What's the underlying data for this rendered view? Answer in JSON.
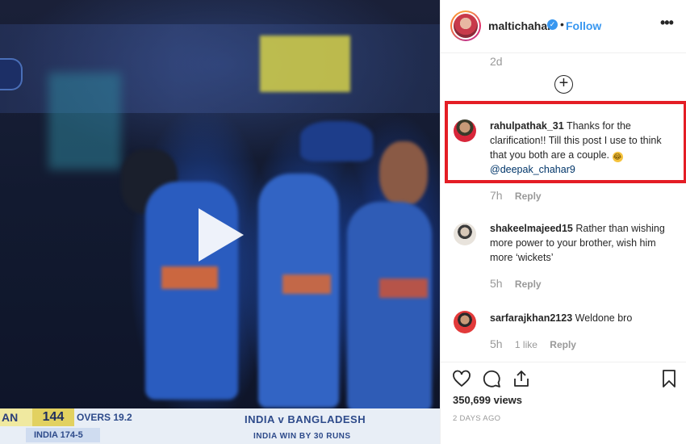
{
  "video": {
    "scoreboard": {
      "team": "AN",
      "score": "144",
      "overs": "OVERS 19.2",
      "innings": "INDIA 174-5 (20)",
      "match": "INDIA v BANGLADESH",
      "result": "INDIA WIN BY 30 RUNS"
    }
  },
  "post": {
    "username": "maltichahar",
    "verified_glyph": "✓",
    "separator": "•",
    "follow_label": "Follow",
    "more_glyph": "•••",
    "caption_time": "2d",
    "load_more_glyph": "+",
    "views": "350,699 views",
    "posted": "2 DAYS AGO"
  },
  "comments": [
    {
      "user": "rahulpathak_31",
      "text": "Thanks for the clarification!! Till this post I use to think that you both are a couple.",
      "emoji": "😂",
      "mention": "@deepak_chahar9",
      "time": "7h",
      "likes": "",
      "reply": "Reply"
    },
    {
      "user": "shakeelmajeed15",
      "text": "Rather than wishing more power to your brother, wish him more ‘wickets’",
      "time": "5h",
      "likes": "",
      "reply": "Reply"
    },
    {
      "user": "sarfarajkhan2123",
      "text": "Weldone bro",
      "time": "5h",
      "likes": "1 like",
      "reply": "Reply"
    }
  ],
  "icons": {
    "like": "heart-icon",
    "comment": "comment-icon",
    "share": "share-icon",
    "save": "bookmark-icon"
  },
  "colors": {
    "follow": "#3897f0",
    "highlight": "#e41d25"
  }
}
